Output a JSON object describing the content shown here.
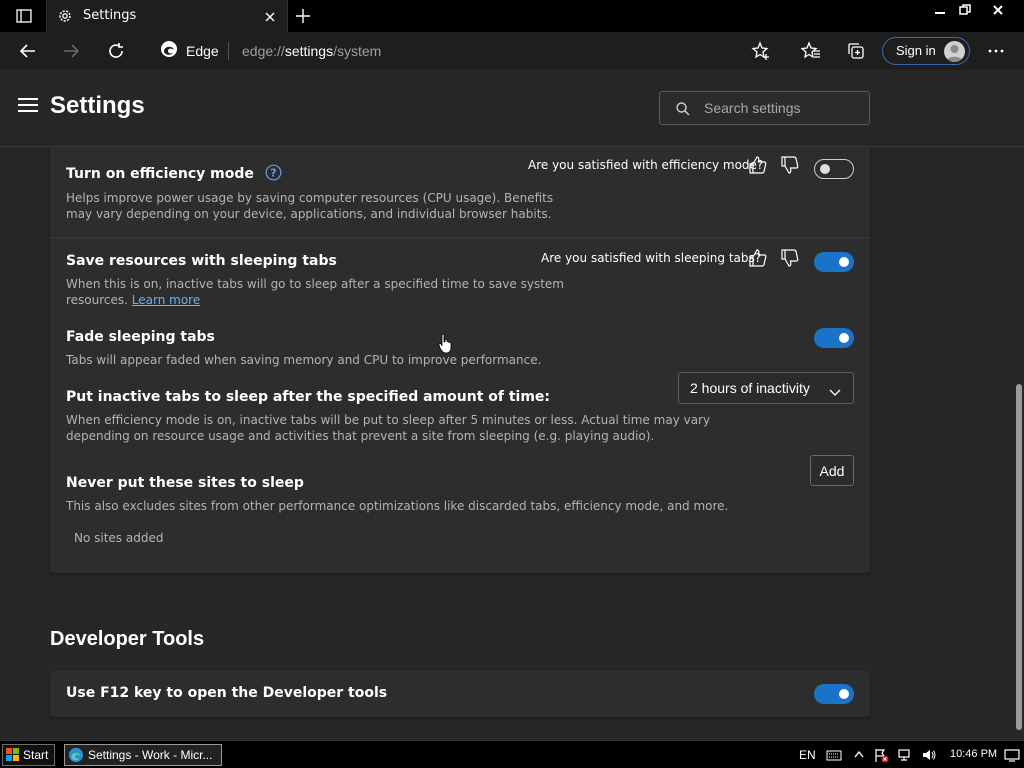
{
  "tab": {
    "title": "Settings"
  },
  "toolbar": {
    "site_label": "Edge",
    "url_scheme": "edge://",
    "url_host": "settings",
    "url_path": "/system",
    "signin_label": "Sign in"
  },
  "header": {
    "title": "Settings",
    "search_placeholder": "Search settings"
  },
  "efficiency": {
    "title": "Turn on efficiency mode",
    "desc_line1": "Helps improve power usage by saving computer resources (CPU usage). Benefits",
    "desc_line2": "may vary depending on your device, applications, and individual browser habits.",
    "feedback_question": "Are you satisfied with efficiency mode?",
    "enabled": false
  },
  "sleeping_tabs": {
    "title": "Save resources with sleeping tabs",
    "desc_line1": "When this is on, inactive tabs will go to sleep after a specified time to save system",
    "desc_line2_prefix": "resources.",
    "learn_more": "Learn more",
    "feedback_question": "Are you satisfied with sleeping tabs?",
    "enabled": true
  },
  "fade_tabs": {
    "title": "Fade sleeping tabs",
    "desc": "Tabs will appear faded when saving memory and CPU to improve performance.",
    "enabled": true
  },
  "sleep_after": {
    "title": "Put inactive tabs to sleep after the specified amount of time:",
    "desc_line1": "When efficiency mode is on, inactive tabs will be put to sleep after 5 minutes or less. Actual time may vary",
    "desc_line2": "depending on resource usage and activities that prevent a site from sleeping (e.g. playing audio).",
    "selected": "2 hours of inactivity"
  },
  "never_sleep": {
    "title": "Never put these sites to sleep",
    "desc": "This also excludes sites from other performance optimizations like discarded tabs, efficiency mode, and more.",
    "add_label": "Add",
    "empty_text": "No sites added"
  },
  "developer": {
    "section_title": "Developer Tools",
    "f12_title": "Use F12 key to open the Developer tools",
    "enabled": true
  },
  "taskbar": {
    "start_label": "Start",
    "task_label": "Settings - Work - Micr...",
    "lang": "EN",
    "clock": "10:46 PM"
  },
  "colors": {
    "accent": "#1a73c8",
    "link": "#6cb0f3",
    "background": "#272727",
    "card": "#2d2d2d"
  }
}
